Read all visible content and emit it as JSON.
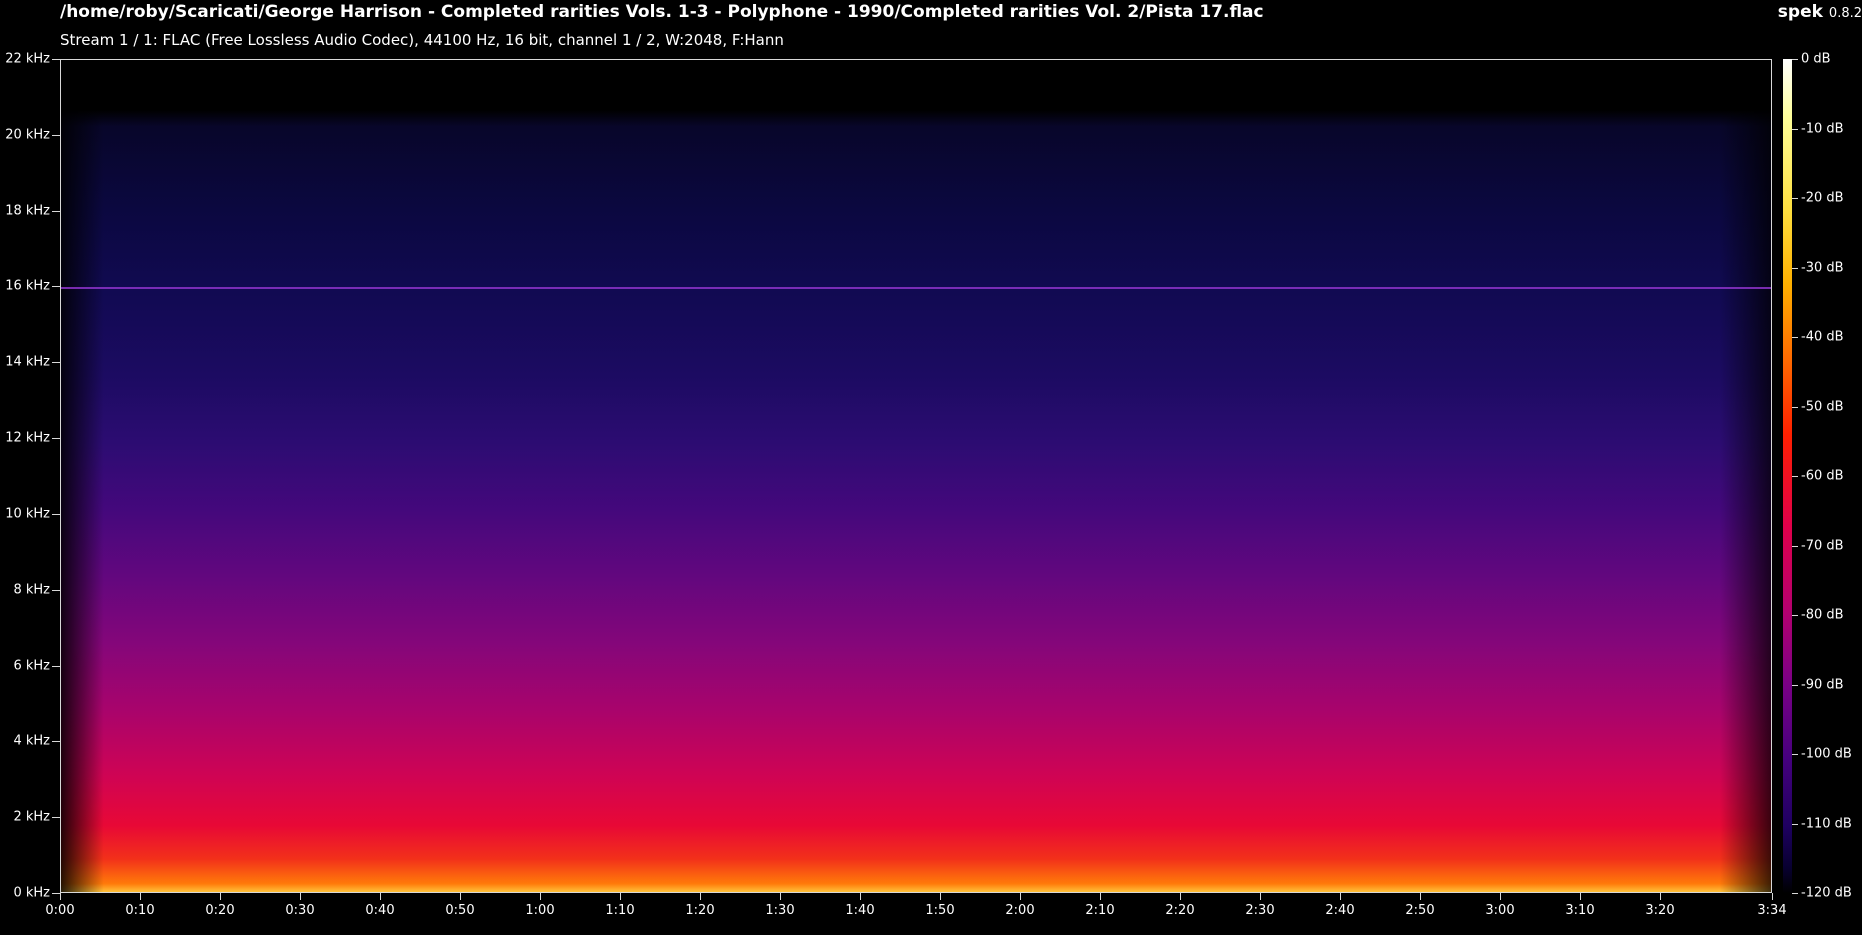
{
  "header": {
    "file_path": "/home/roby/Scaricati/George Harrison - Completed rarities Vols. 1-3 - Polyphone - 1990/Completed rarities Vol. 2/Pista 17.flac",
    "stream_info": "Stream 1 / 1: FLAC (Free Lossless Audio Codec), 44100 Hz, 16 bit, channel 1 / 2, W:2048, F:Hann",
    "app_name": "spek",
    "app_version": "0.8.2"
  },
  "frequency_axis": {
    "labels": [
      "22 kHz",
      "20 kHz",
      "18 kHz",
      "16 kHz",
      "14 kHz",
      "12 kHz",
      "10 kHz",
      "8 kHz",
      "6 kHz",
      "4 kHz",
      "2 kHz",
      "0 kHz"
    ],
    "max_khz": 22
  },
  "time_axis": {
    "labels": [
      "0:00",
      "0:10",
      "0:20",
      "0:30",
      "0:40",
      "0:50",
      "1:00",
      "1:10",
      "1:20",
      "1:30",
      "1:40",
      "1:50",
      "2:00",
      "2:10",
      "2:20",
      "2:30",
      "2:40",
      "2:50",
      "3:00",
      "3:10",
      "3:20",
      "3:34"
    ],
    "duration_seconds": 214
  },
  "color_scale": {
    "labels": [
      "0 dB",
      "-10 dB",
      "-20 dB",
      "-30 dB",
      "-40 dB",
      "-50 dB",
      "-60 dB",
      "-70 dB",
      "-80 dB",
      "-90 dB",
      "-100 dB",
      "-110 dB",
      "-120 dB"
    ],
    "min_db": -120,
    "max_db": 0
  },
  "features": {
    "cutoff_khz": 20.5,
    "tone_line_khz": 16
  }
}
